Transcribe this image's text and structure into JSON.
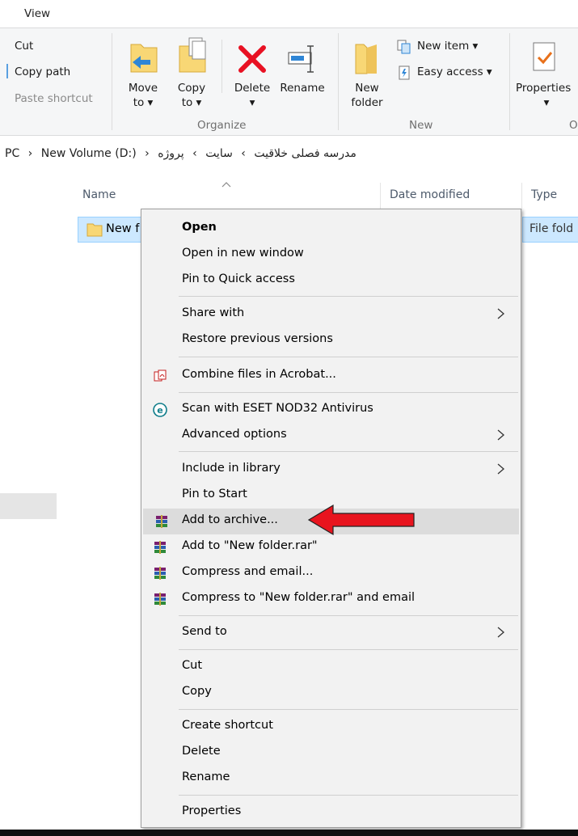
{
  "ribbon": {
    "tab_view": "View",
    "clipboard": {
      "cut": "Cut",
      "copy_path": "Copy path",
      "paste_shortcut": "Paste shortcut"
    },
    "organize": {
      "move_to_l1": "Move",
      "move_to_l2": "to ▾",
      "copy_to_l1": "Copy",
      "copy_to_l2": "to ▾",
      "delete": "Delete",
      "delete_arrow": "▾",
      "rename": "Rename",
      "group_label": "Organize"
    },
    "new": {
      "new_folder_l1": "New",
      "new_folder_l2": "folder",
      "new_item": "New item ▾",
      "easy_access": "Easy access ▾",
      "group_label": "New"
    },
    "open": {
      "properties": "Properties",
      "properties_arrow": "▾",
      "group_label": "O"
    }
  },
  "address": {
    "segments": [
      "PC",
      "›",
      "New Volume (D:)",
      "›",
      "مدرسه فصلی خلاقیت",
      "›",
      "سایت",
      "›",
      "پروژه"
    ]
  },
  "columns": {
    "name": "Name",
    "date_modified": "Date modified",
    "type": "Type"
  },
  "file": {
    "name": "New f",
    "type": "File fold"
  },
  "context_menu": {
    "items": [
      {
        "label": "Open",
        "bold": true
      },
      {
        "label": "Open in new window"
      },
      {
        "label": "Pin to Quick access"
      },
      {
        "label": "Share with",
        "submenu": true
      },
      {
        "label": "Restore previous versions"
      },
      {
        "label": "Combine files in Acrobat...",
        "icon": "acrobat-icon"
      },
      {
        "label": "Scan with ESET NOD32 Antivirus",
        "icon": "eset-icon"
      },
      {
        "label": "Advanced options",
        "submenu": true
      },
      {
        "label": "Include in library",
        "submenu": true
      },
      {
        "label": "Pin to Start"
      },
      {
        "label": "Add to archive...",
        "icon": "winrar-icon",
        "highlighted": true
      },
      {
        "label": "Add to \"New folder.rar\"",
        "icon": "winrar-icon"
      },
      {
        "label": "Compress and email...",
        "icon": "winrar-icon"
      },
      {
        "label": "Compress to \"New folder.rar\" and email",
        "icon": "winrar-icon"
      },
      {
        "label": "Send to",
        "submenu": true
      },
      {
        "label": "Cut"
      },
      {
        "label": "Copy"
      },
      {
        "label": "Create shortcut"
      },
      {
        "label": "Delete"
      },
      {
        "label": "Rename"
      },
      {
        "label": "Properties"
      }
    ]
  },
  "colors": {
    "selection": "#cce8ff",
    "menu_bg": "#f2f2f2",
    "highlight": "#dcdcdc",
    "annotation_arrow": "#e8141e",
    "delete_x": "#e81123",
    "folder": "#f8d775"
  }
}
